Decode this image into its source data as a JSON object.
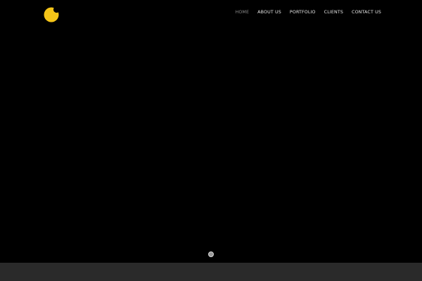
{
  "logo": {
    "icon": "bitten-circle-logo",
    "color": "#F5C518"
  },
  "nav": {
    "items": [
      {
        "label": "HOME",
        "active": true
      },
      {
        "label": "ABOUT US",
        "active": false
      },
      {
        "label": "PORTFOLIO",
        "active": false
      },
      {
        "label": "CLIENTS",
        "active": false
      },
      {
        "label": "CONTACT US",
        "active": false
      }
    ]
  },
  "slider": {
    "dot_count": 1,
    "active_index": 0
  },
  "colors": {
    "background": "#000000",
    "nav_text": "#e8e8e8",
    "nav_active": "#8c8c8c",
    "footer_band": "#2a2a2a"
  }
}
